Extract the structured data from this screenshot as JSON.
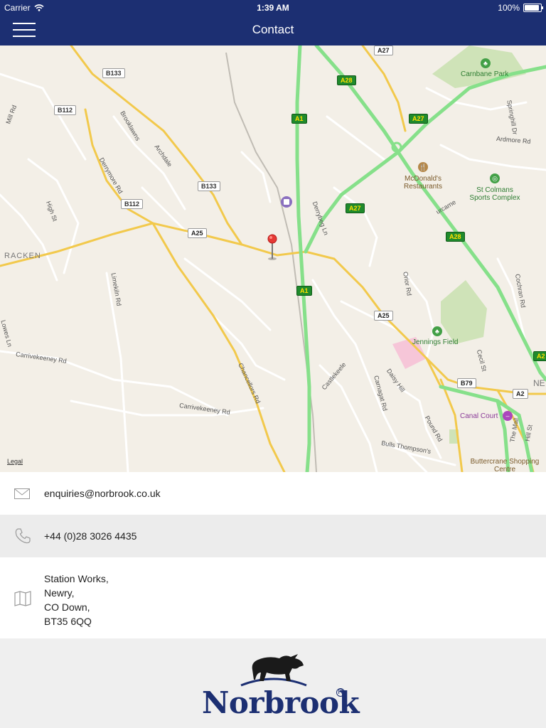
{
  "status_bar": {
    "carrier": "Carrier",
    "time": "1:39 AM",
    "battery": "100%",
    "battery_level": 1.0
  },
  "nav": {
    "title": "Contact"
  },
  "map": {
    "legal": "Legal",
    "shields": {
      "b133_top": "B133",
      "b112_left": "B112",
      "b133_mid": "B133",
      "b112_mid": "B112",
      "a27_top": "A27",
      "a28_top": "A28",
      "a1_top": "A1",
      "a27_mid": "A27",
      "a27_low": "A27",
      "a28_mid": "A28",
      "a25_left": "A25",
      "a1_low": "A1",
      "a25_right": "A25",
      "b79": "B79",
      "a2": "A2",
      "a28_edge": "A2"
    },
    "labels": {
      "mill_rd": "Mill Rd",
      "brooklawns": "Brooklawns",
      "archdale": "Archdale",
      "derrymore_rd": "Derrymore Rd",
      "high_st": "High St",
      "racken": "RACKEN",
      "derrybeg_ln": "Derrybeg Ln",
      "limekiln_rd": "Limekiln Rd",
      "carrivekeeney_rd_1": "Carrivekeeney Rd",
      "carrivekeeney_rd_2": "Carrivekeeney Rd",
      "chancellors_rd": "Chancellors Rd",
      "castlekeele": "Castlekeele",
      "carnagat_rd": "Carnagat Rd",
      "daisy_hill": "Daisy Hill",
      "pound_rd": "Pound Rd",
      "bulls_thompsons": "Bulls Thompson's",
      "ardmore_rd": "Ardmore Rd",
      "springhill_dr": "Springhill Dr",
      "orior_rd": "Orior Rd",
      "cochrane_rd": "Cochran Rd",
      "cecil_st": "Cecil St",
      "the_mall": "The Mall",
      "hill_st": "Hill St",
      "lowes_ln": "Lowes Ln",
      "ne": "NE",
      "lurcarne": "urcarne"
    },
    "pois": {
      "carnbane_park": "Carnbane Park",
      "mcdonalds": "McDonald's Restaurants",
      "st_colmans": "St Colmans Sports Complex",
      "jennings_field": "Jennings Field",
      "canal_court": "Canal Court",
      "buttercrane": "Buttercrane Shopping Centre"
    }
  },
  "contact": {
    "email": "enquiries@norbrook.co.uk",
    "phone": "+44 (0)28 3026 4435",
    "address": [
      "Station Works,",
      "Newry,",
      "CO Down,",
      "BT35 6QQ"
    ]
  },
  "footer": {
    "logo_text": "Norbrook",
    "registered_mark": "R"
  },
  "colors": {
    "nav_bg": "#1c2f72",
    "motorway_green": "#86e08a",
    "road_yellow": "#f2c94c",
    "pin_red": "#e53935"
  }
}
